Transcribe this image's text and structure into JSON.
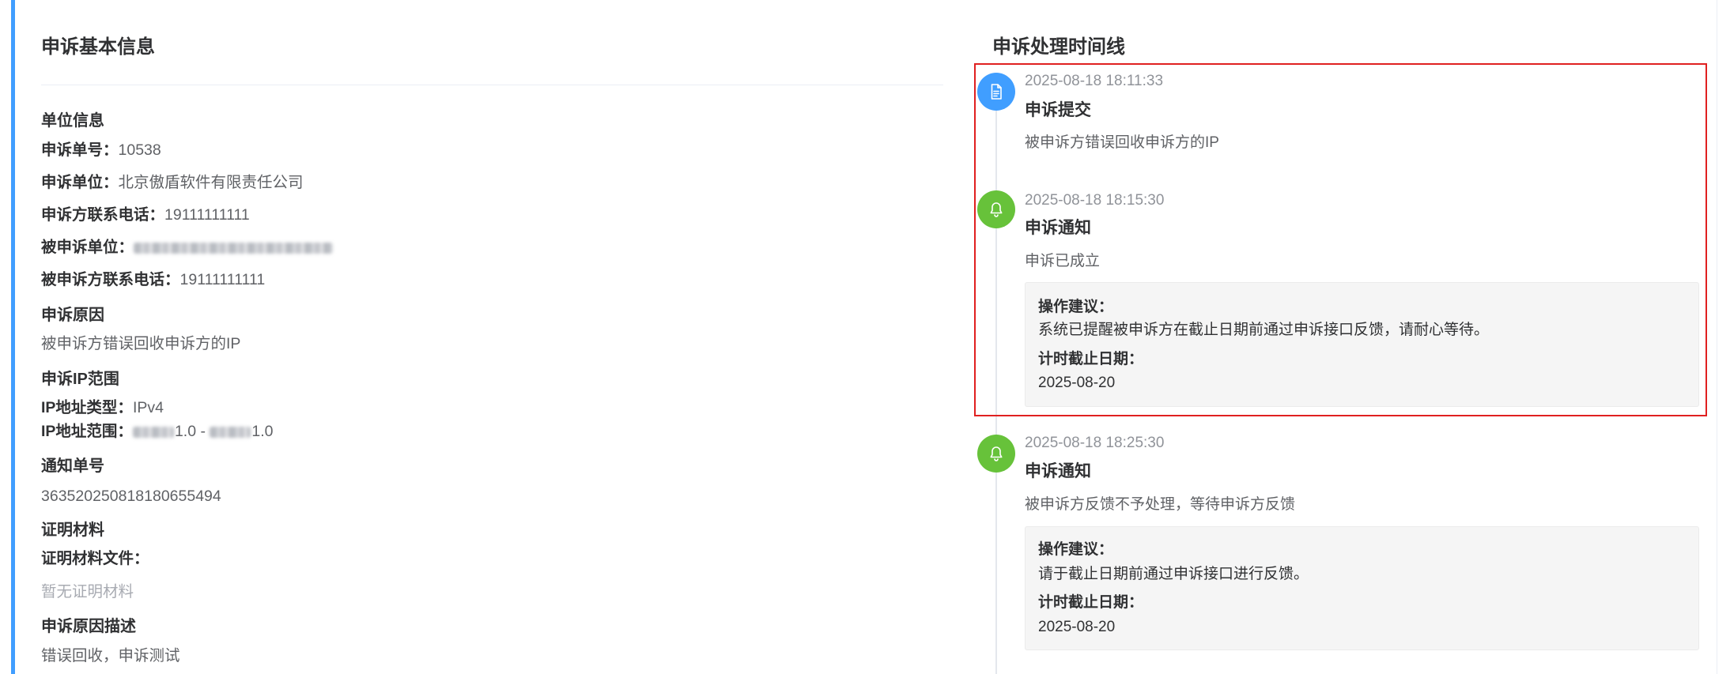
{
  "colors": {
    "accent": "#409eff",
    "success": "#67c23a",
    "highlight": "#e02020"
  },
  "basic_info": {
    "title": "申诉基本信息",
    "unit": {
      "heading": "单位信息",
      "ticket_no": {
        "label": "申诉单号：",
        "value": "10538"
      },
      "complainant_org": {
        "label": "申诉单位：",
        "value": "北京傲盾软件有限责任公司"
      },
      "complainant_phone": {
        "label": "申诉方联系电话：",
        "value": "19111111111"
      },
      "respondent_org": {
        "label": "被申诉单位："
      },
      "respondent_phone": {
        "label": "被申诉方联系电话：",
        "value": "19111111111"
      }
    },
    "reason": {
      "heading": "申诉原因",
      "value": "被申诉方错误回收申诉方的IP"
    },
    "ip_scope": {
      "heading": "申诉IP范围",
      "type_label": "IP地址类型：",
      "type_value": "IPv4",
      "range_label": "IP地址范围：",
      "range_start_visible": "1.0",
      "range_separator": " - ",
      "range_end_visible": "1.0"
    },
    "notice": {
      "heading": "通知单号",
      "value": "363520250818180655494"
    },
    "evidence": {
      "heading": "证明材料",
      "files_label": "证明材料文件：",
      "empty_text": "暂无证明材料"
    },
    "description": {
      "heading": "申诉原因描述",
      "value": "错误回收，申诉测试"
    }
  },
  "timeline": {
    "title": "申诉处理时间线",
    "events": [
      {
        "time": "2025-08-18 18:11:33",
        "title": "申诉提交",
        "desc": "被申诉方错误回收申诉方的IP",
        "icon": "document-icon"
      },
      {
        "time": "2025-08-18 18:15:30",
        "title": "申诉通知",
        "desc": "申诉已成立",
        "icon": "bell-icon",
        "advice_label": "操作建议：",
        "advice": "系统已提醒被申诉方在截止日期前通过申诉接口反馈，请耐心等待。",
        "deadline_label": "计时截止日期：",
        "deadline": "2025-08-20"
      },
      {
        "time": "2025-08-18 18:25:30",
        "title": "申诉通知",
        "desc": "被申诉方反馈不予处理，等待申诉方反馈",
        "icon": "bell-icon",
        "advice_label": "操作建议：",
        "advice": "请于截止日期前通过申诉接口进行反馈。",
        "deadline_label": "计时截止日期：",
        "deadline": "2025-08-20"
      }
    ]
  }
}
